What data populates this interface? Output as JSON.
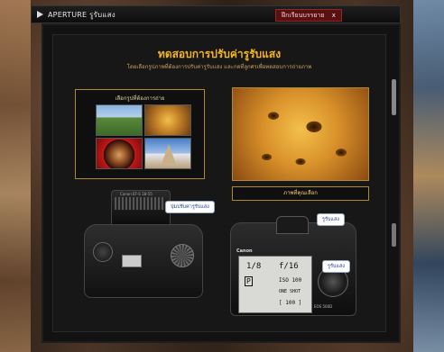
{
  "window": {
    "title": "APERTURE รูรับแสง",
    "tab_label": "ฝึกเรียนบรรยาย",
    "tab_close": "x"
  },
  "main": {
    "heading": "ทดสอบการปรับค่ารูรับแสง",
    "subheading": "โดยเลือกรูปภาพที่ต้องการปรับค่ารูรับแสง และกดที่ลูกศรเพื่อทดสอบการถ่ายภาพ"
  },
  "chooser": {
    "label": "เลือกรูปที่ต้องการถ่าย"
  },
  "preview": {
    "caption": "ภาพที่คุณเลือก"
  },
  "callouts": {
    "top_camera": "ปุ่มปรับค่ารูรับแสง",
    "back_camera_top": "รูรับแสง",
    "back_camera_side": "รูรับแสง"
  },
  "camera_top": {
    "lens_text": "Canon EF-S 18-55"
  },
  "camera_back": {
    "brand": "Canon",
    "model": "EOS 500D",
    "lcd": {
      "shutter": "1/8",
      "aperture": "f/16",
      "mode": "P",
      "iso": "ISO 100",
      "shot": "ONE SHOT",
      "count": "[ 100 ]"
    }
  }
}
